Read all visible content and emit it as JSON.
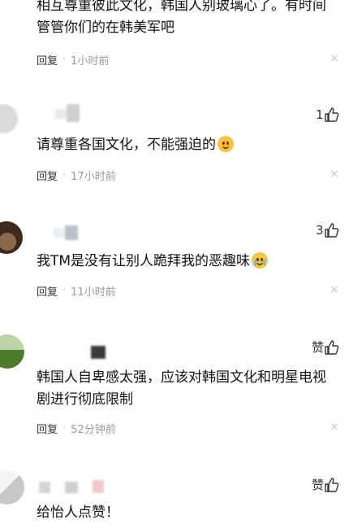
{
  "comments": [
    {
      "text": "相互尊重彼此文化，韩国人别玻璃心了。有时间管管你们的在韩美军吧",
      "reply": "回复",
      "time": "1小时前",
      "like": ""
    },
    {
      "text": "请尊重各国文化，不能强迫的",
      "emoji": "smirk-emoji",
      "reply": "回复",
      "time": "17小时前",
      "like_count": "1"
    },
    {
      "text": "我TM是没有让别人跪拜我的恶趣味",
      "emoji": "crying-laughing-emoji",
      "reply": "回复",
      "time": "11小时前",
      "like_count": "3"
    },
    {
      "text": "韩国人自卑感太强，应该对韩国文化和明星电视剧进行彻底限制",
      "reply": "回复",
      "time": "52分钟前",
      "like_label": "赞"
    },
    {
      "text": "给怡人点赞！",
      "like_label": "赞"
    }
  ],
  "dot": "·",
  "close_glyph": "×",
  "colors": {
    "text": "#111111",
    "time": "#999999",
    "close": "#c9c9c9"
  }
}
